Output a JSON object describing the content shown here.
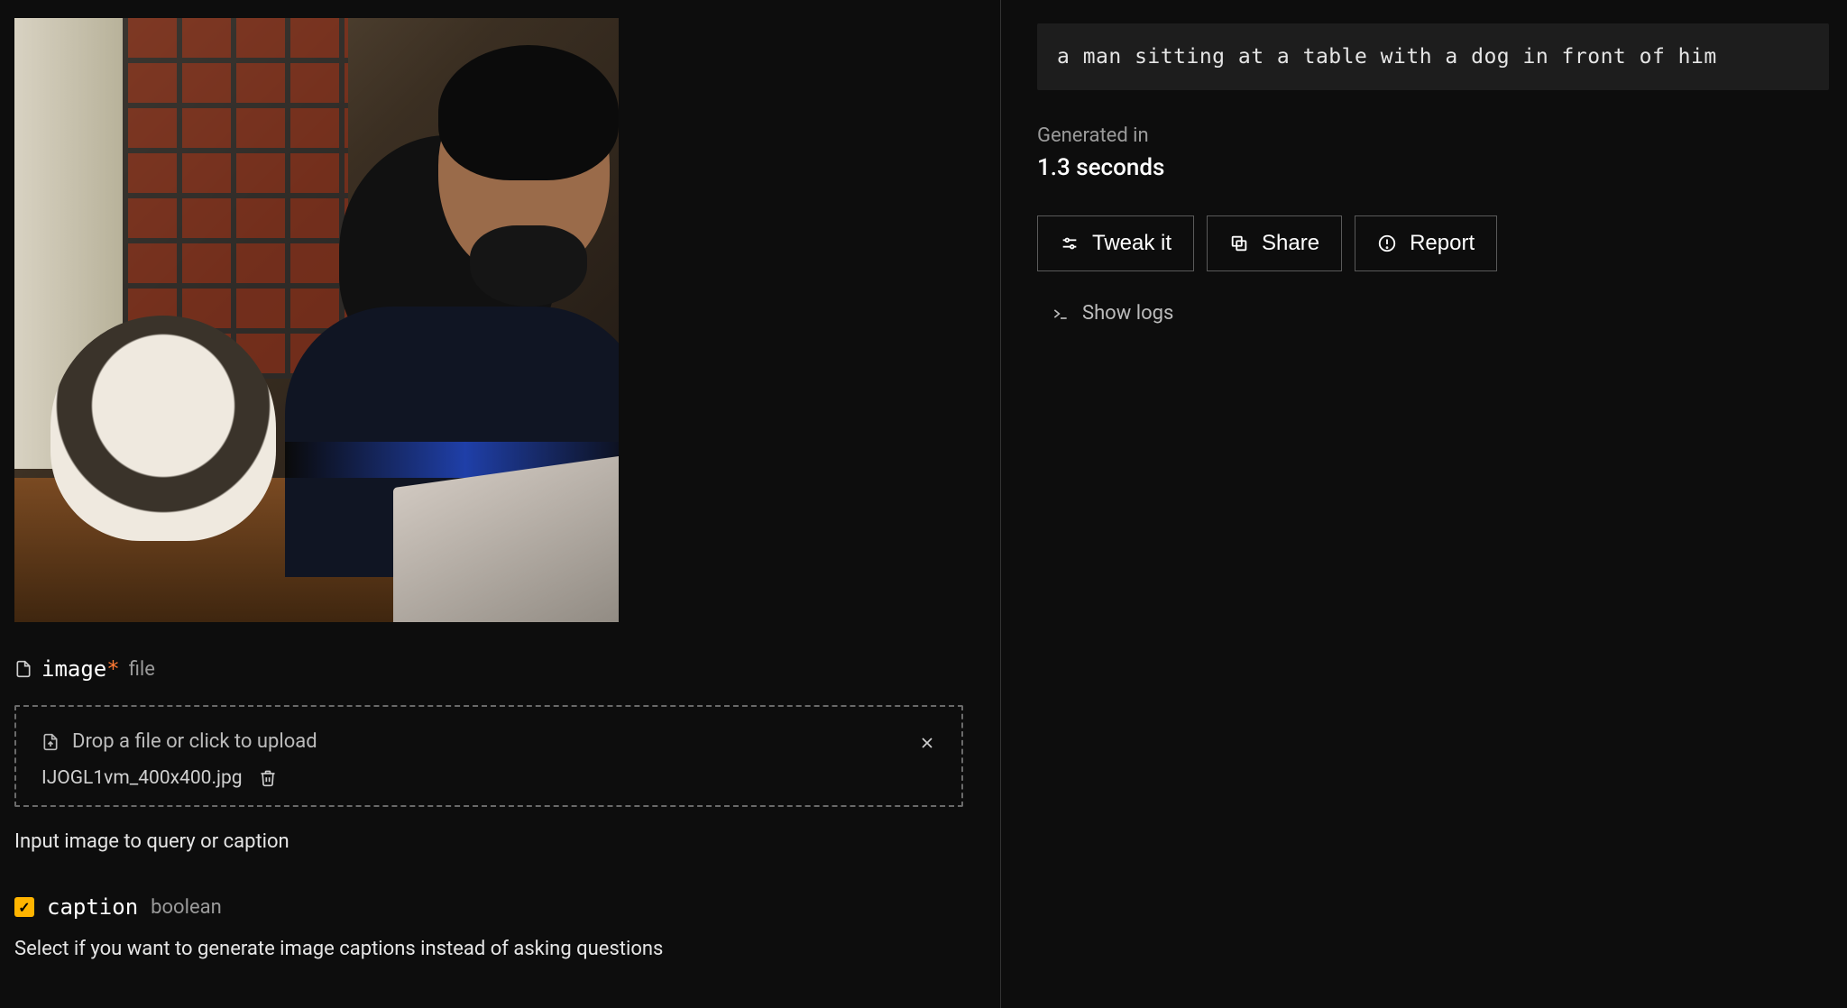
{
  "input": {
    "image_field": {
      "name": "image",
      "required_marker": "*",
      "type_label": "file",
      "dropzone_prompt": "Drop a file or click to upload",
      "filename": "IJOGL1vm_400x400.jpg",
      "helper": "Input image to query or caption"
    },
    "caption_field": {
      "name": "caption",
      "type_label": "boolean",
      "checked": true,
      "helper": "Select if you want to generate image captions instead of asking questions"
    }
  },
  "output": {
    "caption_text": "a man sitting at a table with a dog in front of him",
    "generated_label": "Generated in",
    "generated_time": "1.3 seconds",
    "buttons": {
      "tweak": "Tweak it",
      "share": "Share",
      "report": "Report"
    },
    "show_logs": "Show logs"
  }
}
